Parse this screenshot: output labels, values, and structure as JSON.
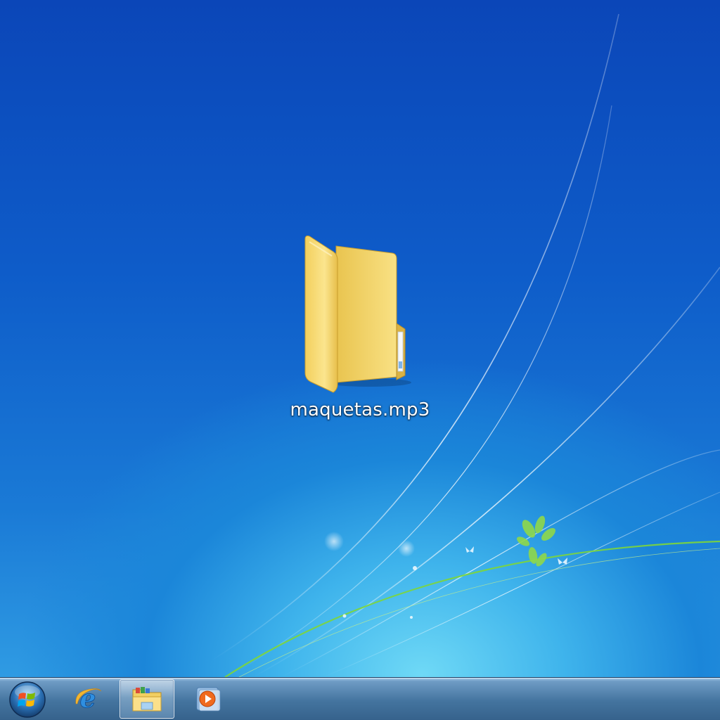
{
  "desktop": {
    "icons": [
      {
        "label": "maquetas.mp3",
        "icon": "folder-icon"
      }
    ]
  },
  "taskbar": {
    "start_icon": "windows-logo-icon",
    "pinned": [
      {
        "app": "internet-explorer",
        "icon": "internet-explorer-icon",
        "active": false
      },
      {
        "app": "windows-explorer",
        "icon": "folder-library-icon",
        "active": true
      },
      {
        "app": "media-player",
        "icon": "media-player-icon",
        "active": false
      }
    ]
  },
  "colors": {
    "wallpaper_top": "#0b46b8",
    "wallpaper_glow": "#6fd9f6",
    "folder_yellow": "#f5d76e",
    "taskbar": "#44749f"
  }
}
